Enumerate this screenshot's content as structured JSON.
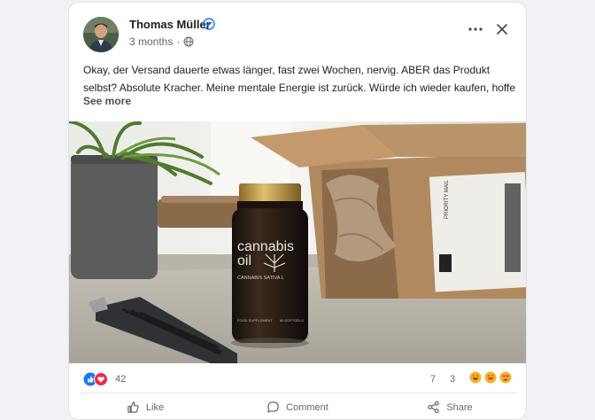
{
  "post": {
    "author": "Thomas Müller",
    "time": "3 months",
    "separator": "·",
    "text": "Okay, der Versand dauerte etwas länger, fast zwei Wochen, nervig. ABER das Produkt selbst? Absolute Kracher. Meine mentale Energie ist zurück. Würde ich wieder kaufen, hoffe",
    "see_more": "See more"
  },
  "photo": {
    "bottle_label_line1": "cannabis",
    "bottle_label_line2": "oil",
    "bottle_label_sub": "CANNABIS SATIVA L",
    "bottle_small_left": "FOOD SUPPLEMENT",
    "bottle_small_right": "60 SOFTGELS",
    "box_label": "PRIORITY MAIL"
  },
  "reactions": {
    "count": "42",
    "comments": "7",
    "shares": "3",
    "icons": [
      "like-icon",
      "love-icon"
    ],
    "emojis": [
      "laugh-emoji",
      "haha-emoji",
      "love-eyes-emoji"
    ]
  },
  "actions": {
    "like": "Like",
    "comment": "Comment",
    "share": "Share"
  },
  "colors": {
    "brand_blue": "#1877f2",
    "love_red": "#f02849",
    "text_secondary": "#65676b"
  }
}
